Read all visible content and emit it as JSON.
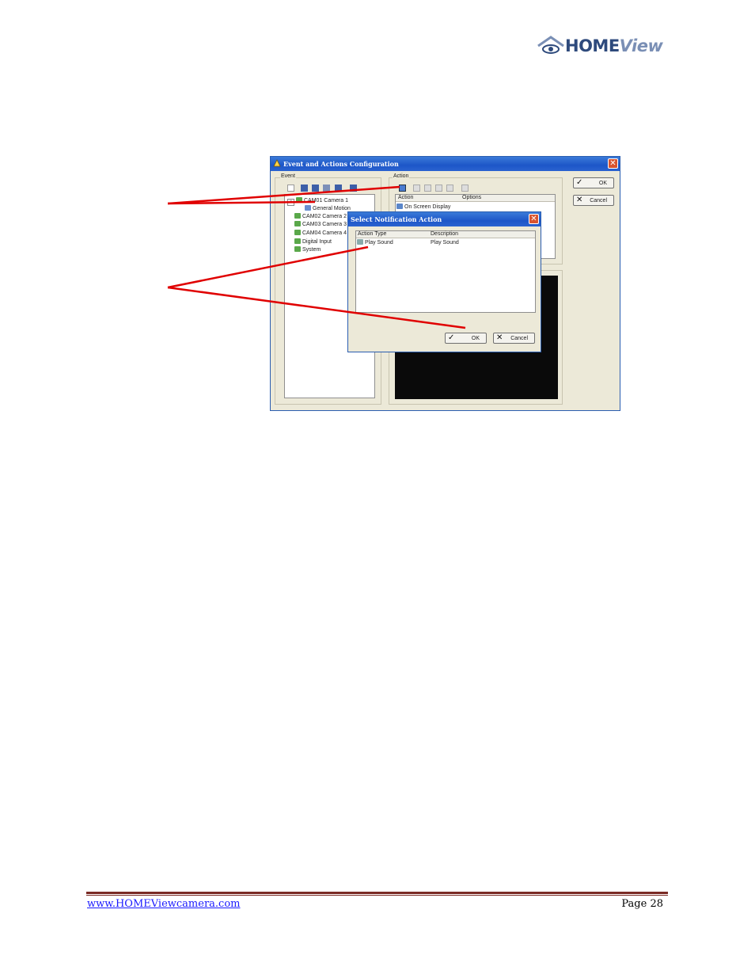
{
  "brand": {
    "logo_text_1": "HOME",
    "logo_text_2": "View",
    "accent": "#2e4a7c"
  },
  "main_window": {
    "title": "Event and Actions Configuration",
    "close": "✕",
    "event_group_label": "Event",
    "action_group_label": "Action",
    "tree": [
      {
        "label": "CAM01 Camera 1",
        "icon": "camera-icon",
        "expanded": "−"
      },
      {
        "label": "General Motion",
        "icon": "motion-icon"
      },
      {
        "label": "CAM02 Camera 2",
        "icon": "camera-icon"
      },
      {
        "label": "CAM03 Camera 3",
        "icon": "camera-icon"
      },
      {
        "label": "CAM04 Camera 4",
        "icon": "camera-icon"
      },
      {
        "label": "Digital Input",
        "icon": "input-icon"
      },
      {
        "label": "System",
        "icon": "system-icon"
      }
    ],
    "action_list": {
      "columns": [
        "Action",
        "Options"
      ],
      "rows": [
        {
          "action": "On Screen Display",
          "options": ""
        }
      ]
    },
    "ok_label": "OK",
    "cancel_label": "Cancel"
  },
  "dialog": {
    "title": "Select Notification Action",
    "close": "✕",
    "columns": [
      "Action Type",
      "Description"
    ],
    "rows": [
      {
        "type": "Play Sound",
        "description": "Play Sound"
      }
    ],
    "ok_label": "OK",
    "cancel_label": "Cancel"
  },
  "footer": {
    "link": "www.HOMEViewcamera.com",
    "page": "Page 28",
    "rule_color": "#7a2a24"
  },
  "annotation_color": "#e00000"
}
